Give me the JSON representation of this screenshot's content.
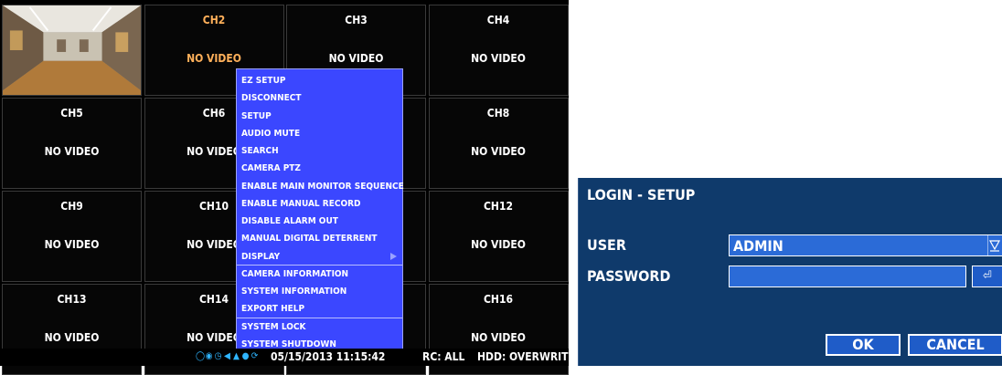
{
  "grid": {
    "channels": [
      {
        "label": "",
        "status": "",
        "live": true
      },
      {
        "label": "CH2",
        "status": "NO VIDEO",
        "selected": true
      },
      {
        "label": "CH3",
        "status": "NO VIDEO"
      },
      {
        "label": "CH4",
        "status": "NO VIDEO"
      },
      {
        "label": "CH5",
        "status": "NO VIDEO"
      },
      {
        "label": "CH6",
        "status": "NO VIDEO"
      },
      {
        "label": "",
        "status": ""
      },
      {
        "label": "CH8",
        "status": "NO VIDEO"
      },
      {
        "label": "CH9",
        "status": "NO VIDEO"
      },
      {
        "label": "CH10",
        "status": "NO VIDEO"
      },
      {
        "label": "",
        "status": ""
      },
      {
        "label": "CH12",
        "status": "NO VIDEO"
      },
      {
        "label": "CH13",
        "status": "NO VIDEO"
      },
      {
        "label": "CH14",
        "status": "NO VIDEO"
      },
      {
        "label": "",
        "status": ""
      },
      {
        "label": "CH16",
        "status": "NO VIDEO"
      }
    ]
  },
  "menu": {
    "items": [
      "EZ SETUP",
      "DISCONNECT",
      "SETUP",
      "AUDIO MUTE",
      "SEARCH",
      "CAMERA PTZ",
      "ENABLE MAIN MONITOR SEQUENCE",
      "ENABLE MANUAL RECORD",
      "DISABLE ALARM OUT",
      "MANUAL DIGITAL DETERRENT",
      "DISPLAY",
      "CAMERA INFORMATION",
      "SYSTEM INFORMATION",
      "EXPORT HELP",
      "SYSTEM LOCK",
      "SYSTEM SHUTDOWN"
    ]
  },
  "status_bar": {
    "datetime": "05/15/2013 11:15:42",
    "rc": "RC: ALL",
    "hdd": "HDD: OVERWRITE",
    "icons": [
      "network-icon",
      "record-icon",
      "clock-icon",
      "audio-icon",
      "ptz-icon",
      "user-icon",
      "refresh-icon"
    ]
  },
  "login": {
    "title": "LOGIN - SETUP",
    "user_label": "USER",
    "user_value": "ADMIN",
    "password_label": "PASSWORD",
    "password_value": "",
    "ok_label": "OK",
    "cancel_label": "CANCEL"
  },
  "colors": {
    "menu_bg": "#3b47ff",
    "dialog_bg": "#0f3a6b",
    "selected_channel": "#ffb05a"
  }
}
